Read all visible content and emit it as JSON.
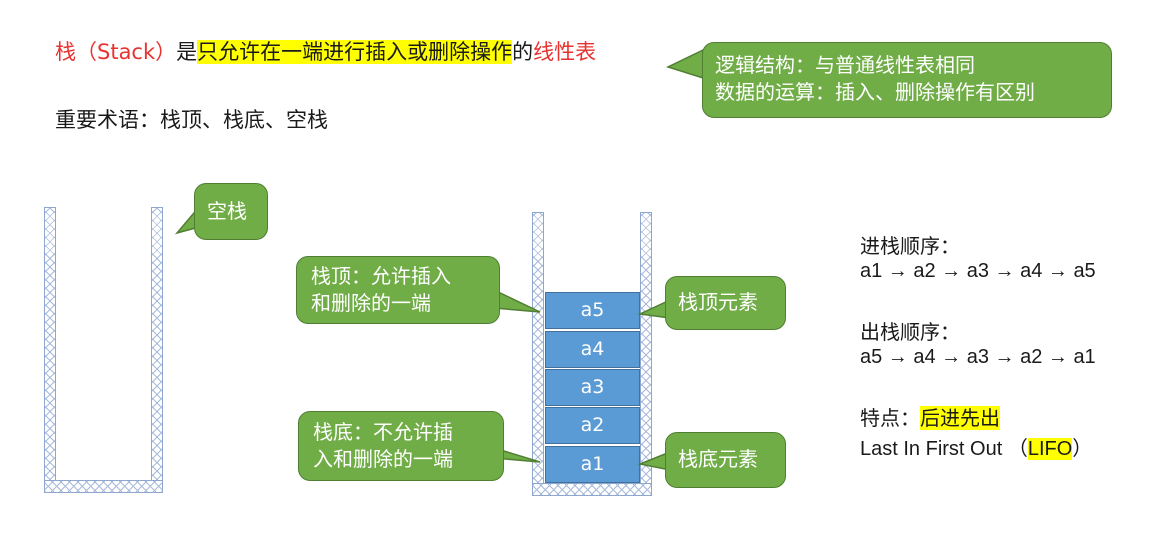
{
  "definition": {
    "term": "栈（Stack）",
    "is": "是",
    "highlight": "只允许在一端进行插入或删除操作",
    "of": "的",
    "linear_list": "线性表"
  },
  "terms_line": "重要术语：栈顶、栈底、空栈",
  "callouts": {
    "logic_line1": "逻辑结构：与普通线性表相同",
    "logic_line2": "数据的运算：插入、删除操作有区别",
    "empty_stack": "空栈",
    "top_line1": "栈顶：允许插入",
    "top_line2": "和删除的一端",
    "bottom_line1": "栈底：不允许插",
    "bottom_line2": "入和删除的一端",
    "top_element": "栈顶元素",
    "bottom_element": "栈底元素"
  },
  "stack_elements": [
    "a5",
    "a4",
    "a3",
    "a2",
    "a1"
  ],
  "push_order": {
    "label": "进栈顺序：",
    "sequence": "a1 → a2 → a3 → a4 → a5"
  },
  "pop_order": {
    "label": "出栈顺序：",
    "sequence": "a5 → a4 → a3 → a2 → a1"
  },
  "feature": {
    "label": "特点：",
    "value": "后进先出",
    "english_prefix": "Last In First Out （",
    "acronym": "LIFO",
    "english_suffix": "）"
  },
  "colors": {
    "callout_fill": "#70ad47",
    "cell_fill": "#5b9bd5",
    "highlight": "#ffff00",
    "red_text": "#e8322f"
  }
}
